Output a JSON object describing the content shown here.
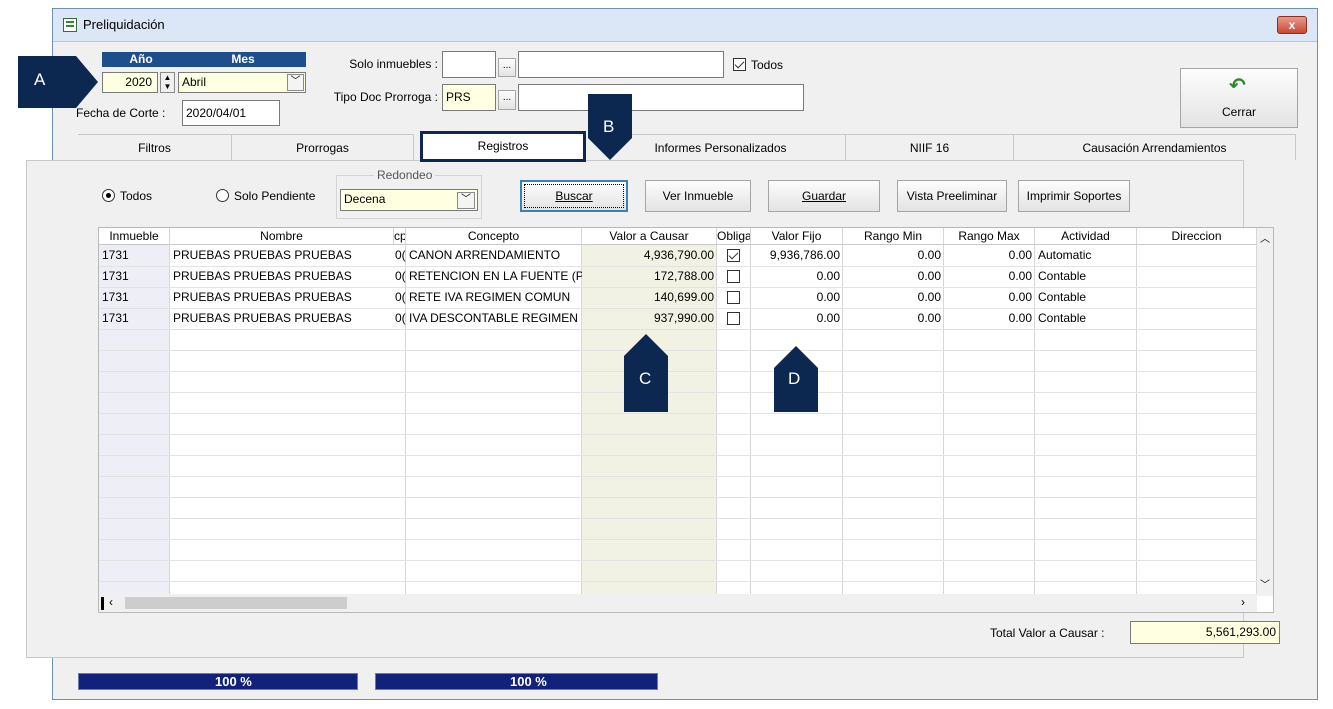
{
  "window": {
    "title": "Preliquidación",
    "close_glyph": "x"
  },
  "period": {
    "year_header": "Año",
    "month_header": "Mes",
    "year": "2020",
    "month": "Abril"
  },
  "cutoff": {
    "label": "Fecha de Corte :",
    "value": "2020/04/01"
  },
  "filters": {
    "solo_inmuebles_label": "Solo inmuebles :",
    "solo_inmuebles_value": "",
    "solo_inmuebles_desc": "",
    "todos_label": "Todos",
    "todos_checked": true,
    "tipo_doc_label": "Tipo Doc Prorroga :",
    "tipo_doc_value": "PRS",
    "tipo_doc_desc": "",
    "browse_label": "..."
  },
  "close_button": {
    "label": "Cerrar",
    "icon": "undo-arrow-icon"
  },
  "tabs": [
    {
      "label": "Filtros",
      "active": false
    },
    {
      "label": "Prorrogas",
      "active": false
    },
    {
      "label": "Registros",
      "active": true
    },
    {
      "label": "Informes Personalizados",
      "active": false
    },
    {
      "label": "NIIF 16",
      "active": false
    },
    {
      "label": "Causación Arrendamientos",
      "active": false
    }
  ],
  "options": {
    "todos_label": "Todos",
    "pendiente_label": "Solo Pendiente",
    "selected": "Todos",
    "redondeo_label": "Redondeo",
    "redondeo_value": "Decena"
  },
  "actions": {
    "buscar": "Buscar",
    "ver_inmueble": "Ver Inmueble",
    "guardar": "Guardar",
    "vista_preeliminar": "Vista Preeliminar",
    "imprimir_soportes": "Imprimir Soportes"
  },
  "grid": {
    "columns": [
      "Inmueble",
      "Nombre",
      "cp",
      "Concepto",
      "Valor a Causar",
      "Obliga",
      "Valor Fijo",
      "Rango Min",
      "Rango Max",
      "Actividad",
      "Direccion"
    ],
    "rows": [
      {
        "inmueble": "1731",
        "nombre": "PRUEBAS PRUEBAS PRUEBAS",
        "cp": "0(",
        "concepto": "CANON ARRENDAMIENTO",
        "valor_causar": "4,936,790.00",
        "obliga": true,
        "valor_fijo": "9,936,786.00",
        "rango_min": "0.00",
        "rango_max": "0.00",
        "actividad": "Automatic",
        "direccion": ""
      },
      {
        "inmueble": "1731",
        "nombre": "PRUEBAS PRUEBAS PRUEBAS",
        "cp": "0(",
        "concepto": "RETENCION EN LA FUENTE (P",
        "valor_causar": "172,788.00",
        "obliga": false,
        "valor_fijo": "0.00",
        "rango_min": "0.00",
        "rango_max": "0.00",
        "actividad": "Contable",
        "direccion": ""
      },
      {
        "inmueble": "1731",
        "nombre": "PRUEBAS PRUEBAS PRUEBAS",
        "cp": "0(",
        "concepto": "RETE IVA REGIMEN COMUN",
        "valor_causar": "140,699.00",
        "obliga": false,
        "valor_fijo": "0.00",
        "rango_min": "0.00",
        "rango_max": "0.00",
        "actividad": "Contable",
        "direccion": ""
      },
      {
        "inmueble": "1731",
        "nombre": "PRUEBAS PRUEBAS PRUEBAS",
        "cp": "0(",
        "concepto": "IVA DESCONTABLE REGIMEN",
        "valor_causar": "937,990.00",
        "obliga": false,
        "valor_fijo": "0.00",
        "rango_min": "0.00",
        "rango_max": "0.00",
        "actividad": "Contable",
        "direccion": ""
      }
    ]
  },
  "total": {
    "label": "Total Valor a Causar :",
    "value": "5,561,293.00"
  },
  "progress": [
    {
      "label": "100 %",
      "percent": 100
    },
    {
      "label": "100 %",
      "percent": 100
    }
  ],
  "markers": {
    "a": "A",
    "b": "B",
    "c": "C",
    "d": "D"
  },
  "colors": {
    "marker": "#0d2850",
    "header_blue": "#1f4e8c",
    "highlight_column": "#f1f1e4",
    "progress": "#12217a"
  }
}
